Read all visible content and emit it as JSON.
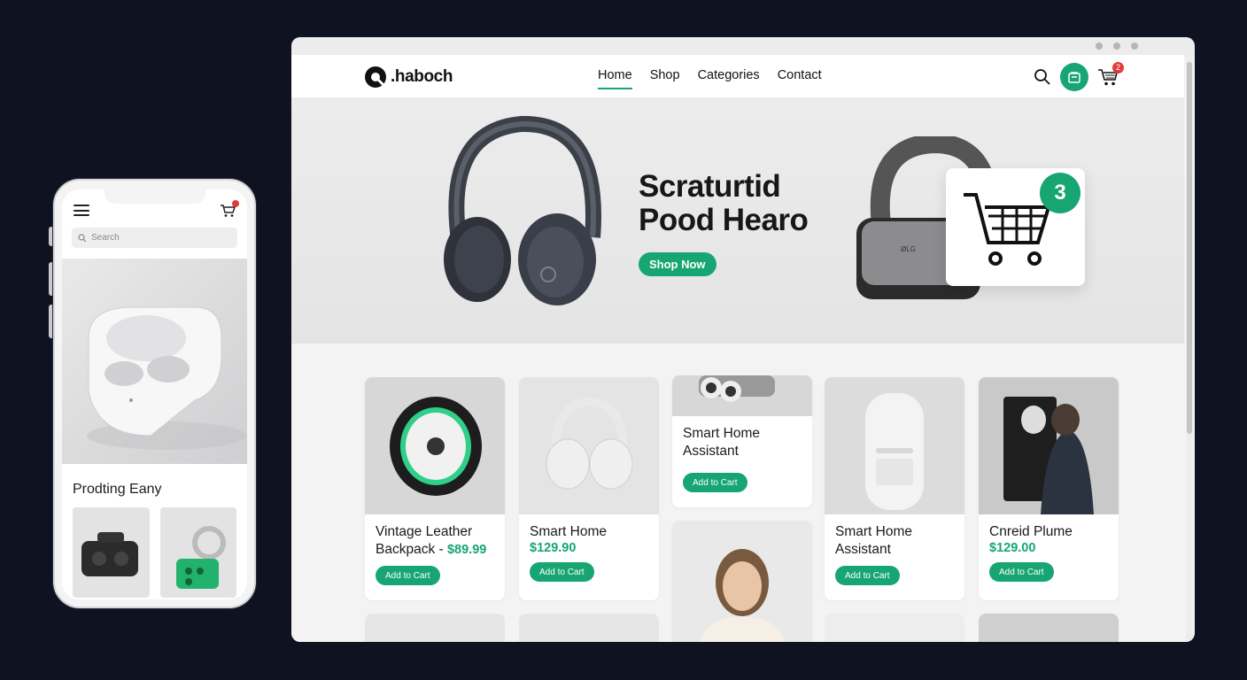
{
  "mobile": {
    "search_placeholder": "Search",
    "section_title": "Prodting Eany"
  },
  "browser": {
    "logo_text": ".haboch",
    "nav": {
      "links": [
        "Home",
        "Shop",
        "Categories",
        "Contact"
      ],
      "active": "Home",
      "cart_count": "2"
    },
    "hero": {
      "title_line1": "Scraturtid",
      "title_line2": "Pood Hearo",
      "cta_label": "Shop Now",
      "cart_card_count": "3"
    },
    "products": [
      {
        "name": "Vintage Leather Backpack -",
        "price": "$89.99",
        "button": "Add to Cart"
      },
      {
        "name": "Smart Home",
        "price": "$129.90",
        "button": "Add to Cart"
      },
      {
        "name": "Smart Home Assistant",
        "price": "",
        "button": "Add to Cart"
      },
      {
        "name": "Smart Home Assistant",
        "price": "",
        "button": "Add to Cart"
      },
      {
        "name": "Cnreid Plume",
        "price": "$129.00",
        "button": "Add to Cart"
      }
    ]
  },
  "colors": {
    "background": "#0f1220",
    "accent": "#17a673",
    "badge": "#e23b3b"
  }
}
